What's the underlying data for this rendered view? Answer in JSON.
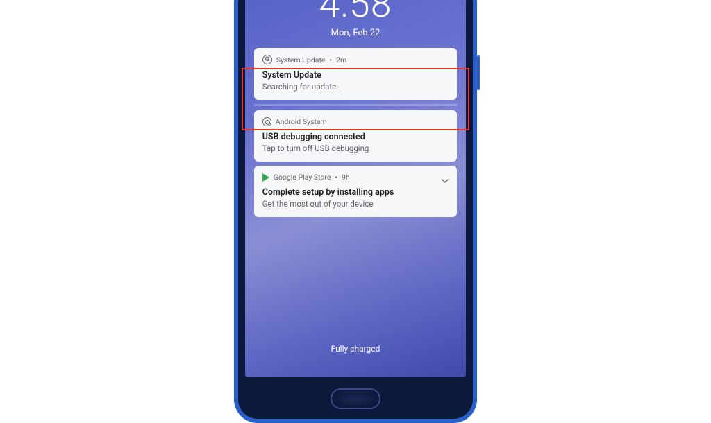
{
  "lockscreen": {
    "time": "4:58",
    "date": "Mon, Feb 22",
    "status": "Fully charged"
  },
  "notifications": [
    {
      "app": "System Update",
      "age": "2m",
      "title": "System Update",
      "body": "Searching for update..",
      "icon": "google-g-icon",
      "highlighted": true
    },
    {
      "app": "Android System",
      "age": "",
      "title": "USB debugging connected",
      "body": "Tap to turn off USB debugging",
      "icon": "android-gear-icon",
      "highlighted": false
    },
    {
      "app": "Google Play Store",
      "age": "9h",
      "title": "Complete setup by installing apps",
      "body": "Get the most out of your device",
      "icon": "play-store-icon",
      "expandable": true,
      "highlighted": false
    }
  ],
  "highlight_color": "#e83a2a"
}
